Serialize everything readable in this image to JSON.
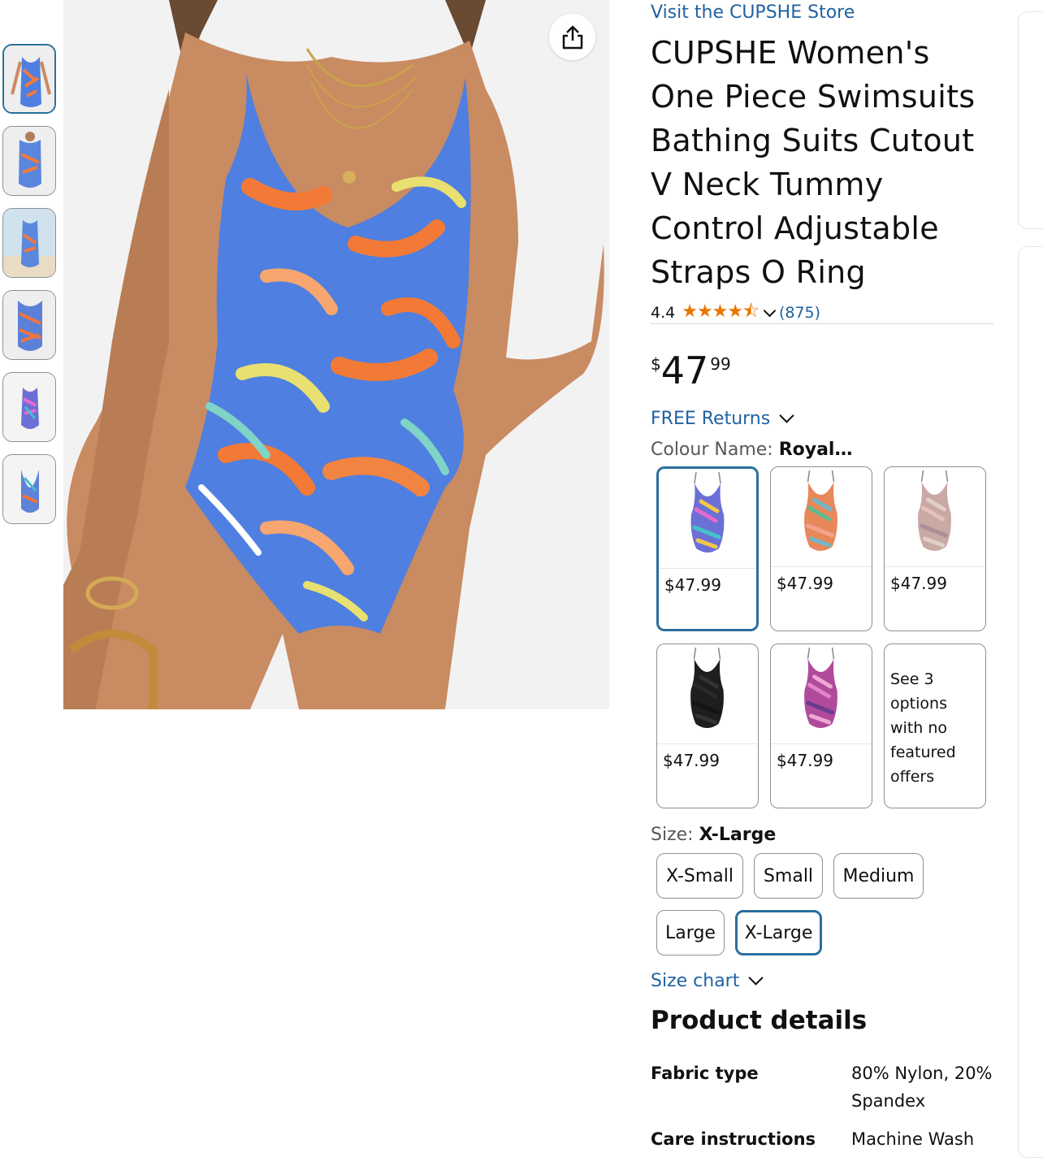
{
  "gallery": {
    "thumbnail_count": 6,
    "active_thumbnail_index": 0
  },
  "product": {
    "store_link": "Visit the CUPSHE Store",
    "title": "CUPSHE Women's One Piece Swimsuits Bathing Suits Cutout V Neck Tummy Control Adjustable Straps O Ring",
    "rating": "4.4",
    "rating_value": 4.4,
    "review_count": "(875)",
    "price": {
      "symbol": "$",
      "whole": "47",
      "fraction": "99"
    },
    "returns": "FREE Returns"
  },
  "colour": {
    "label": "Colour Name: ",
    "value": "Royal…",
    "options": [
      {
        "price": "$47.99",
        "selected": true,
        "palette": [
          "#6b6fd6",
          "#e46ad0",
          "#45c1c9",
          "#f0c74a"
        ]
      },
      {
        "price": "$47.99",
        "selected": false,
        "palette": [
          "#e8875a",
          "#5bbd8f",
          "#f2a48a",
          "#6fb7c9"
        ]
      },
      {
        "price": "$47.99",
        "selected": false,
        "palette": [
          "#c9a9a4",
          "#e6c1b9",
          "#a98f98",
          "#e0d0c8"
        ]
      },
      {
        "price": "$47.99",
        "selected": false,
        "palette": [
          "#1e1e20",
          "#2a2a2d",
          "#141416",
          "#333336"
        ]
      },
      {
        "price": "$47.99",
        "selected": false,
        "palette": [
          "#b04b9c",
          "#e384c8",
          "#6a3b8f",
          "#f0a7d5"
        ]
      }
    ],
    "unavailable_text": "See 3 options with no featured offers"
  },
  "size": {
    "label": "Size: ",
    "value": "X-Large",
    "options": [
      "X-Small",
      "Small",
      "Medium",
      "Large",
      "X-Large"
    ],
    "selected": "X-Large",
    "chart_link": "Size chart"
  },
  "details": {
    "heading": "Product details",
    "rows": [
      {
        "key": "Fabric type",
        "value": "80% Nylon, 20% Spandex"
      },
      {
        "key": "Care instructions",
        "value": "Machine Wash"
      }
    ]
  },
  "colors": {
    "link": "#2162a1",
    "selected_border": "#2b6f9e",
    "star": "#e77600"
  }
}
